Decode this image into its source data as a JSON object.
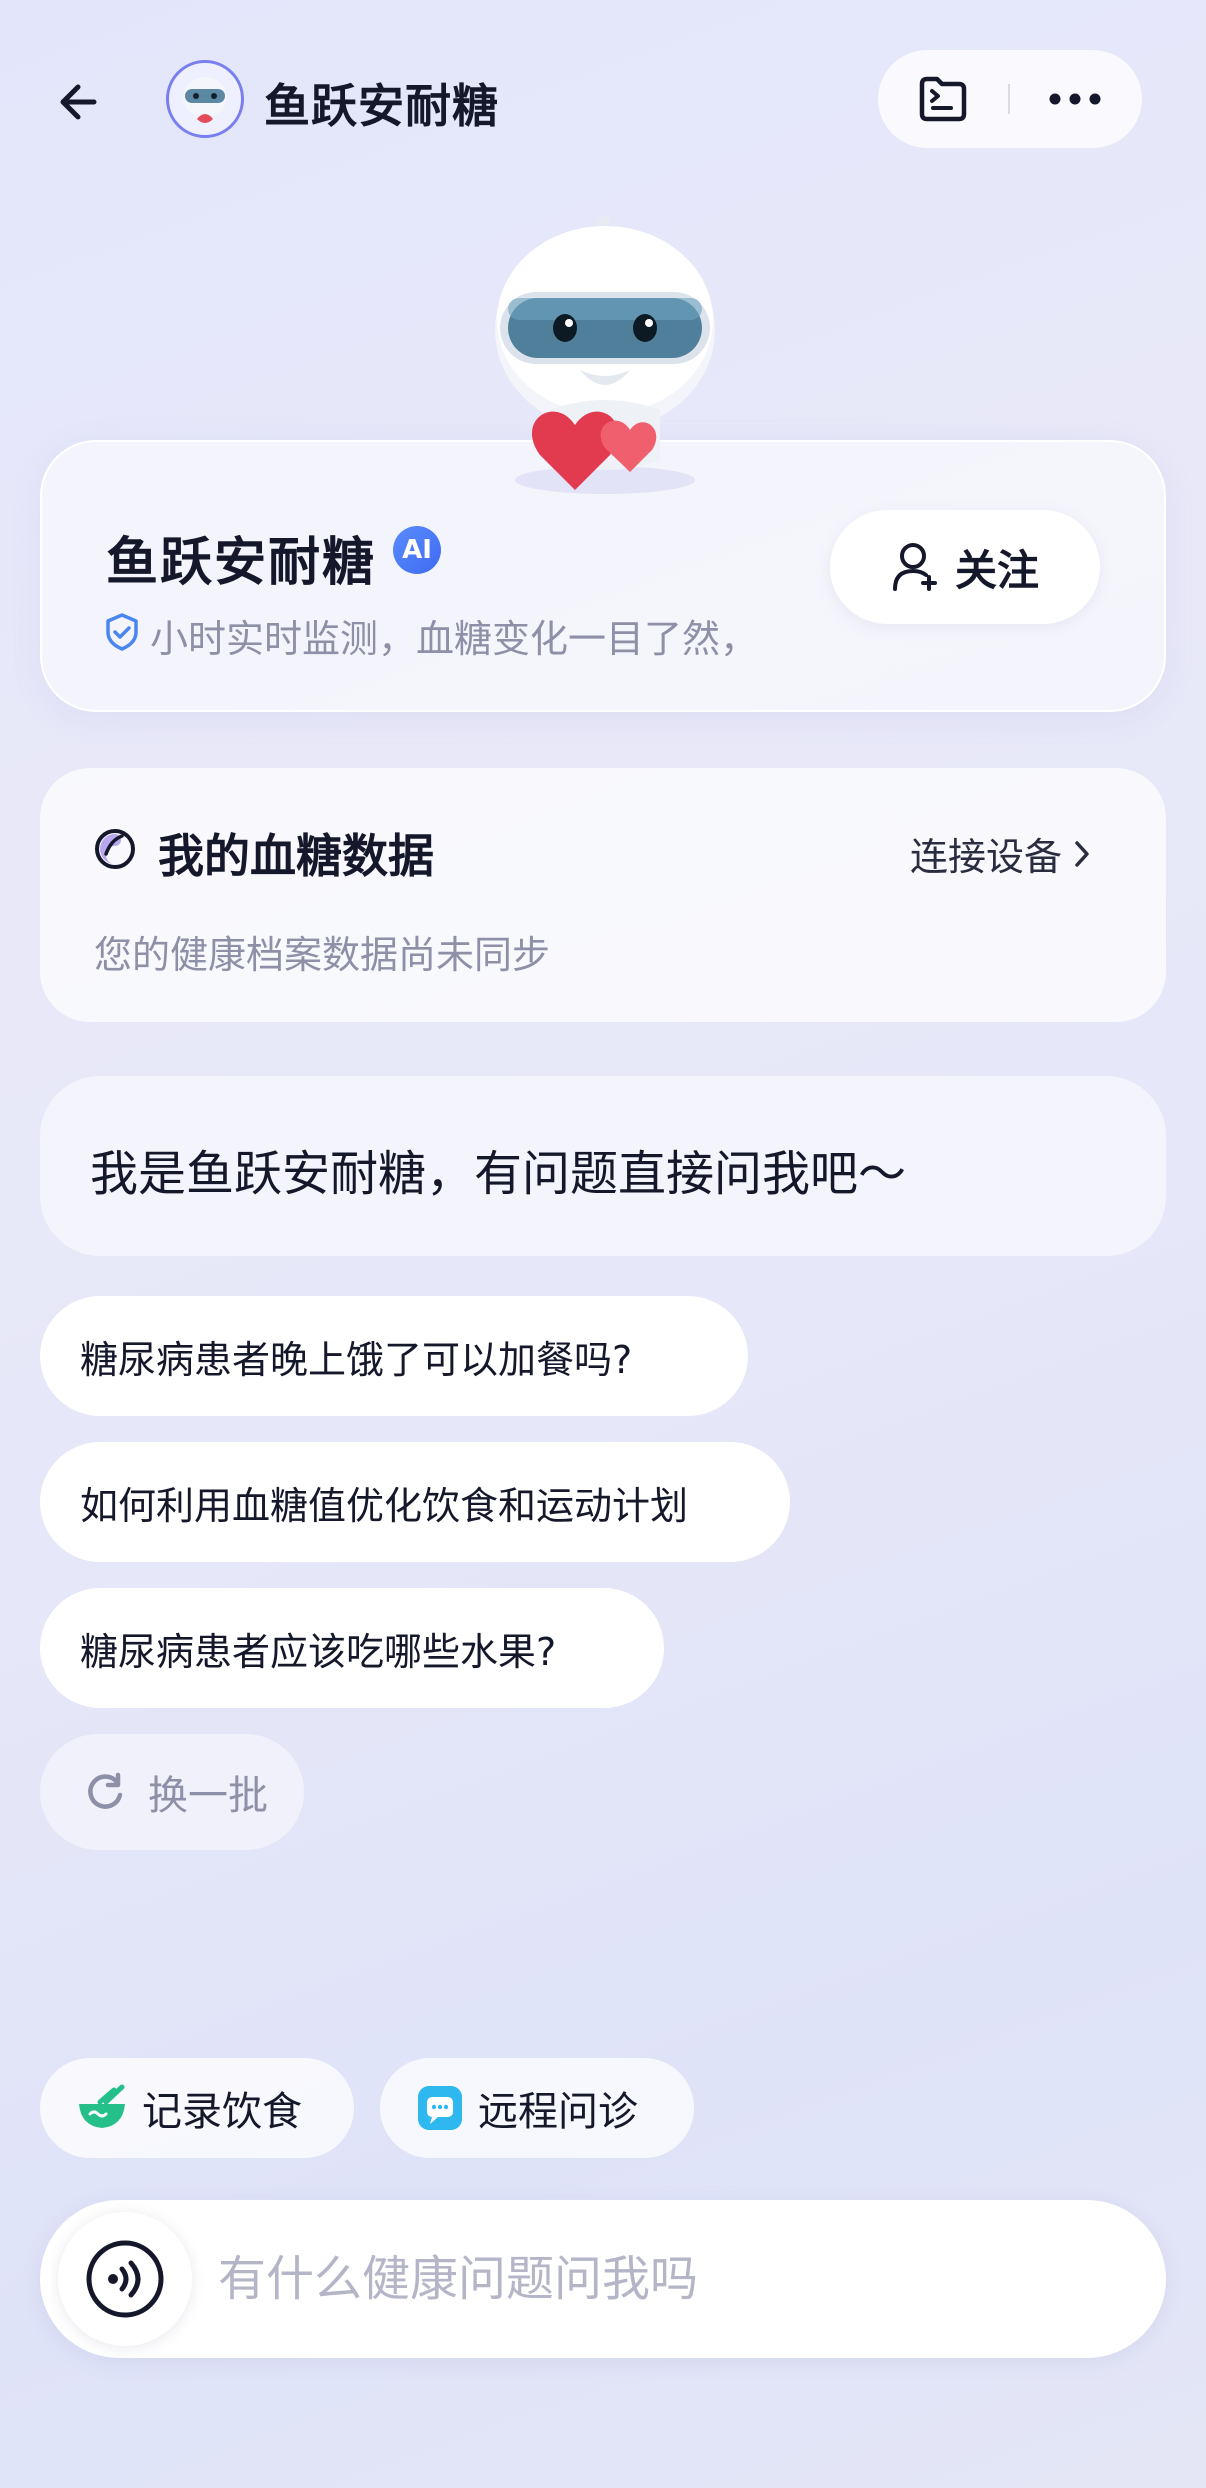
{
  "header": {
    "title": "鱼跃安耐糖",
    "icons": {
      "back": "arrow-left-icon",
      "folder": "folder-icon",
      "more": "more-dots-icon"
    }
  },
  "profile": {
    "name": "鱼跃安耐糖",
    "ai_badge": "AI",
    "description": "小时实时监测，血糖变化一目了然，",
    "follow_label": "关注"
  },
  "blood_sugar": {
    "title": "我的血糖数据",
    "connect_label": "连接设备",
    "status": "您的健康档案数据尚未同步"
  },
  "greeting": "我是鱼跃安耐糖，有问题直接问我吧～",
  "suggestions": [
    "糖尿病患者晚上饿了可以加餐吗?",
    "如何利用血糖值优化饮食和运动计划",
    "糖尿病患者应该吃哪些水果?"
  ],
  "refresh_label": "换一批",
  "actions": [
    {
      "label": "记录饮食",
      "icon": "bowl-icon"
    },
    {
      "label": "远程问诊",
      "icon": "chat-bubble-icon"
    }
  ],
  "input": {
    "placeholder": "有什么健康问题问我吗"
  },
  "colors": {
    "accent": "#4a74f5",
    "green": "#25c08a",
    "cyan": "#2fb8f0"
  }
}
